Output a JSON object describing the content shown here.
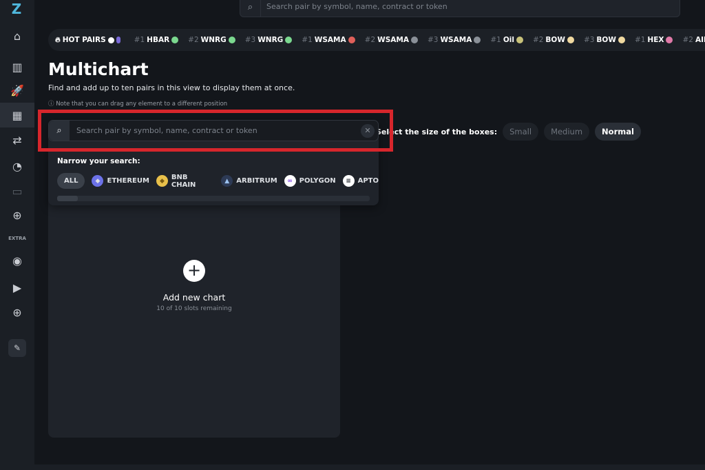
{
  "sidebar": {
    "logo": "Z",
    "items": [
      {
        "name": "home",
        "icon": "⌂"
      },
      {
        "name": "charts",
        "icon": "▥"
      },
      {
        "name": "launch",
        "icon": "🚀"
      },
      {
        "name": "multichart",
        "icon": "▦"
      },
      {
        "name": "swap",
        "icon": "⇄"
      },
      {
        "name": "stats",
        "icon": "◔"
      },
      {
        "name": "wallet",
        "icon": "▭"
      },
      {
        "name": "add",
        "icon": "⊕"
      }
    ],
    "extra_label": "EXTRA",
    "extra_items": [
      {
        "name": "fire",
        "icon": "◉"
      },
      {
        "name": "youtube",
        "icon": "▶"
      },
      {
        "name": "globe",
        "icon": "⊕"
      }
    ],
    "feedback_icon": "✎"
  },
  "top_search": {
    "placeholder": "Search pair by symbol, name, contract or token"
  },
  "hot_pairs": {
    "label": "HOT PAIRS",
    "items": [
      {
        "rank": "#1",
        "symbol": "HBAR",
        "color": "#7bd88f"
      },
      {
        "rank": "#2",
        "symbol": "WNRG",
        "color": "#7bd88f"
      },
      {
        "rank": "#3",
        "symbol": "WNRG",
        "color": "#7bd88f"
      },
      {
        "rank": "#1",
        "symbol": "WSAMA",
        "color": "#e0605a"
      },
      {
        "rank": "#2",
        "symbol": "WSAMA",
        "color": "#8a9098"
      },
      {
        "rank": "#3",
        "symbol": "WSAMA",
        "color": "#8a9098"
      },
      {
        "rank": "#1",
        "symbol": "Oil",
        "color": "#c8c27a"
      },
      {
        "rank": "#2",
        "symbol": "BOW",
        "color": "#f0d9a0"
      },
      {
        "rank": "#3",
        "symbol": "BOW",
        "color": "#f0d9a0"
      },
      {
        "rank": "#1",
        "symbol": "HEX",
        "color": "#e07aa8"
      },
      {
        "rank": "#2",
        "symbol": "AID",
        "color": "#8a9098"
      }
    ]
  },
  "page": {
    "title": "Multichart",
    "subtitle": "Find and add up to ten pairs in this view to display them at once.",
    "note": "Note that you can drag any element to a different position"
  },
  "size_selector": {
    "label": "Select the size of the boxes:",
    "options": [
      "Small",
      "Medium",
      "Normal"
    ],
    "selected": "Normal"
  },
  "search": {
    "placeholder": "Search pair by symbol, name, contract or token",
    "value": "",
    "narrow_label": "Narrow your search:",
    "chains": [
      {
        "label": "ETHEREUM",
        "color": "#6c72e8"
      },
      {
        "label": "BNB CHAIN",
        "color": "#e8c04a"
      },
      {
        "label": "ARBITRUM",
        "color": "#2d3a55"
      },
      {
        "label": "POLYGON",
        "color": "#ffffff"
      },
      {
        "label": "APTO",
        "color": "#ffffff"
      }
    ],
    "all_label": "ALL"
  },
  "chart_slot": {
    "add_label": "Add new chart",
    "remaining": "10 of 10 slots remaining"
  },
  "colors": {
    "highlight": "#d7262c",
    "accent": "#4fb7dc"
  }
}
